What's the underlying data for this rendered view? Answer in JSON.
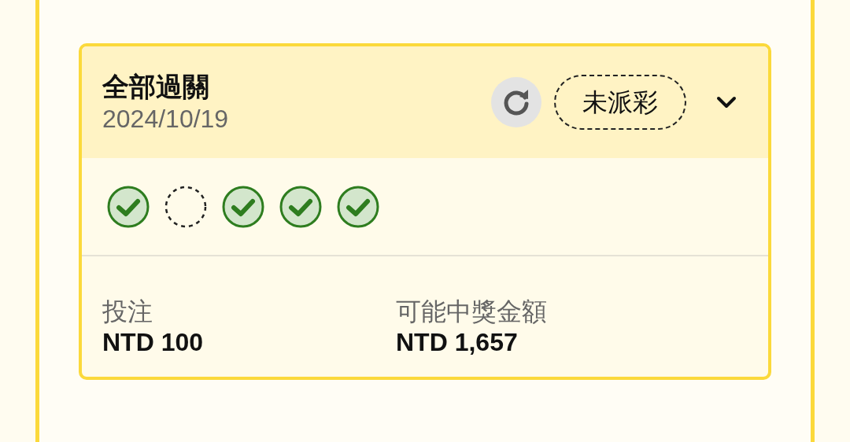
{
  "bet": {
    "title": "全部過關",
    "date": "2024/10/19",
    "status": "未派彩",
    "expanded": false,
    "legs": [
      {
        "kind": "won"
      },
      {
        "kind": "pending"
      },
      {
        "kind": "won"
      },
      {
        "kind": "won"
      },
      {
        "kind": "won"
      }
    ],
    "stake": {
      "label": "投注",
      "value": "NTD 100"
    },
    "payout": {
      "label": "可能中獎金額",
      "value": "NTD 1,657"
    }
  }
}
